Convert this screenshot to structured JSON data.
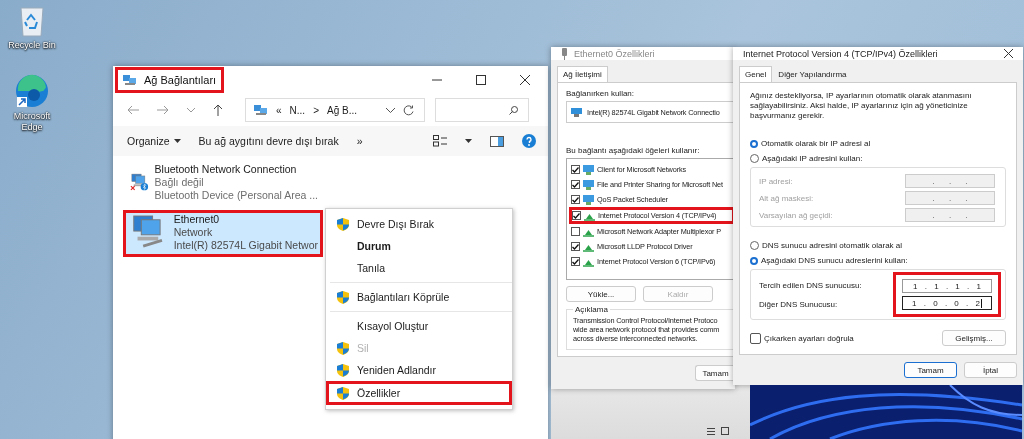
{
  "desktop": {
    "icons": [
      {
        "label": "Recycle Bin",
        "kind": "recycle"
      },
      {
        "label": "Microsoft Edge",
        "kind": "edge"
      }
    ]
  },
  "explorer": {
    "title": "Ağ Bağlantıları",
    "title_highlighted": true,
    "address": {
      "prefix": "«",
      "separator": ">",
      "segments": [
        "N...",
        "Ağ B..."
      ]
    },
    "commands": [
      {
        "label": "Organize",
        "kind": "dropdown"
      },
      {
        "label": "Bu ağ aygıtını devre dışı bırak",
        "kind": "plain"
      },
      {
        "label": "»",
        "kind": "plain"
      }
    ],
    "connections": [
      {
        "name": "Bluetooth Network Connection",
        "status": "Bağlı değil",
        "device": "Bluetooth Device (Personal Area ...",
        "kind": "bluetooth",
        "disconnected": true,
        "selected": false,
        "highlighted": false
      },
      {
        "name": "Ethernet0",
        "status": "Network",
        "device": "Intel(R) 82574L Gigabit Networ",
        "kind": "ethernet",
        "disconnected": false,
        "selected": true,
        "highlighted": true
      }
    ]
  },
  "context_menu": {
    "groups": [
      [
        {
          "label": "Devre Dışı Bırak",
          "shield": true,
          "bold": false,
          "disabled": false,
          "highlighted": false
        },
        {
          "label": "Durum",
          "shield": false,
          "bold": true,
          "disabled": false,
          "highlighted": false
        },
        {
          "label": "Tanıla",
          "shield": false,
          "bold": false,
          "disabled": false,
          "highlighted": false
        }
      ],
      [
        {
          "label": "Bağlantıları Köprüle",
          "shield": true,
          "bold": false,
          "disabled": false,
          "highlighted": false
        }
      ],
      [
        {
          "label": "Kısayol Oluştur",
          "shield": false,
          "bold": false,
          "disabled": false,
          "highlighted": false
        },
        {
          "label": "Sil",
          "shield": true,
          "bold": false,
          "disabled": true,
          "highlighted": false
        },
        {
          "label": "Yeniden Adlandır",
          "shield": true,
          "bold": false,
          "disabled": false,
          "highlighted": false
        },
        {
          "label": "Özellikler",
          "shield": true,
          "bold": false,
          "disabled": false,
          "highlighted": true
        }
      ]
    ]
  },
  "adapter_properties": {
    "title": "Ethernet0 Özellikleri",
    "tabs": [
      {
        "label": "Ağ İletişimi",
        "selected": true
      }
    ],
    "connect_using_label": "Bağlanırken kullan:",
    "adapter": "Intel(R) 82574L Gigabit Network Connectio",
    "items_label": "Bu bağlantı aşağıdaki öğeleri kullanır:",
    "items": [
      {
        "label": "Client for Microsoft Networks",
        "kind": "client",
        "checked": true,
        "highlighted": false
      },
      {
        "label": "File and Printer Sharing for Microsoft Net",
        "kind": "client",
        "checked": true,
        "highlighted": false
      },
      {
        "label": "QoS Packet Scheduler",
        "kind": "client",
        "checked": true,
        "highlighted": false
      },
      {
        "label": "Internet Protocol Version 4 (TCP/IPv4)",
        "kind": "protocol",
        "checked": true,
        "highlighted": true
      },
      {
        "label": "Microsoft Network Adapter Multiplexor P",
        "kind": "protocol",
        "checked": false,
        "highlighted": false
      },
      {
        "label": "Microsoft LLDP Protocol Driver",
        "kind": "protocol",
        "checked": true,
        "highlighted": false
      },
      {
        "label": "Internet Protocol Version 6 (TCP/IPv6)",
        "kind": "protocol",
        "checked": true,
        "highlighted": false
      }
    ],
    "buttons": [
      {
        "label": "Yükle...",
        "disabled": false
      },
      {
        "label": "Kaldır",
        "disabled": true
      }
    ],
    "description_label": "Açıklama",
    "description_lines": [
      "Transmission Control Protocol/Internet Protoco",
      "wide area network protocol that provides comm",
      "across diverse interconnected networks."
    ],
    "ok_button": "Tamam"
  },
  "ipv4_properties": {
    "title": "Internet Protocol Version 4 (TCP/IPv4) Özellikleri",
    "tabs": [
      {
        "label": "Genel",
        "selected": true
      },
      {
        "label": "Diğer Yapılandırma",
        "selected": false
      }
    ],
    "intro": "Ağınız destekliyorsa, IP ayarlarının otomatik olarak atanmasını sağlayabilirsiniz. Aksi halde, IP ayarlarınız için ağ yöneticinize başvurmanız gerekir.",
    "ip_options": [
      {
        "label": "Otomatik olarak bir IP adresi al",
        "selected": true
      },
      {
        "label": "Aşağıdaki IP adresini kullan:",
        "selected": false
      }
    ],
    "ip_fields": [
      {
        "label": "IP adresi:",
        "value": ". . .",
        "disabled": true
      },
      {
        "label": "Alt ağ maskesi:",
        "value": ". . .",
        "disabled": true
      },
      {
        "label": "Varsayılan ağ geçidi:",
        "value": ". . .",
        "disabled": true
      }
    ],
    "dns_options": [
      {
        "label": "DNS sunucu adresini otomatik olarak al",
        "selected": false
      },
      {
        "label": "Aşağıdaki DNS sunucu adreslerini kullan:",
        "selected": true
      }
    ],
    "dns_fields": [
      {
        "label": "Tercih edilen DNS sunucusu:",
        "value": "1 . 1 . 1 . 1",
        "disabled": false,
        "focused": false
      },
      {
        "label": "Diğer DNS Sunucusu:",
        "value": "1 . 0 . 0 . 2",
        "disabled": false,
        "focused": true
      }
    ],
    "dns_highlighted": true,
    "validate": {
      "label": "Çıkarken ayarları doğrula",
      "checked": false
    },
    "advanced_button": "Gelişmiş...",
    "buttons": [
      {
        "label": "Tamam",
        "default": true
      },
      {
        "label": "İptal",
        "default": false
      }
    ]
  }
}
